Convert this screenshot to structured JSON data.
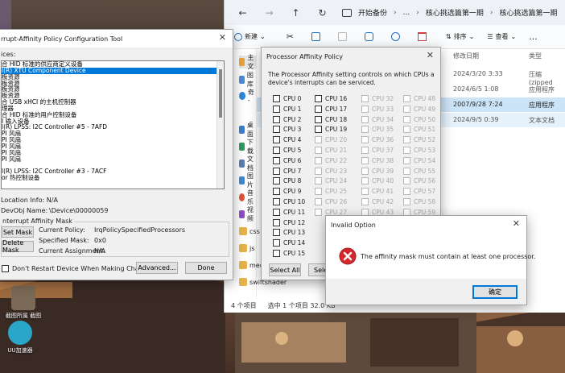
{
  "explorer": {
    "breadcrumb": [
      "开始备份",
      "...",
      "核心挑选篇第一期",
      "核心挑选篇第一期"
    ],
    "toolbar": {
      "new_label": "新建",
      "sort_label": "排序",
      "view_label": "查看",
      "more_label": "..."
    },
    "nav": [
      "主文",
      "图库",
      "奇 -",
      "桌面",
      "下载",
      "文档",
      "图片",
      "音乐",
      "视频",
      "css",
      "js",
      "med",
      "swiftshader"
    ],
    "columns": {
      "date": "修改日期",
      "type": "类型"
    },
    "rows": [
      {
        "date": "2024/3/20 3:33",
        "type": "压缩(zipped",
        "state": "normal"
      },
      {
        "date": "2024/6/5 1:08",
        "type": "应用程序",
        "state": "normal"
      },
      {
        "date": "2007/9/28 7:24",
        "type": "应用程序",
        "state": "selected"
      },
      {
        "date": "2024/9/5 0:39",
        "type": "文本文档",
        "state": "hover"
      }
    ],
    "status": {
      "count": "4 个项目",
      "selected": "选中 1 个项目  32.0 KB"
    }
  },
  "config_dialog": {
    "title": "rrupt-Affinity Policy Configuration Tool",
    "devices_label": "ices:",
    "devices": [
      "合 HID 标准的供应商定义设备",
      "l(R) XTU Component Device",
      "板资源",
      "板资源",
      "板资源",
      "板资源",
      "合 USB xHCI 的主机控制器",
      "理器",
      "合 HID 标准的用户控制设备",
      "I 输入设备",
      "l(R) LPSS: I2C Controller #5 - 7AFD",
      "PI 风扇",
      "PI 风扇",
      "PI 风扇",
      "PI 风扇",
      "PI 风扇",
      "",
      "l(R) LPSS: I2C Controller #3 - 7ACF",
      "or 热控制设备"
    ],
    "selected_device_index": 1,
    "location_info": "Location Info: N/A",
    "devobj_label": "DevObj Name:",
    "devobj_value": "\\Device\\00000059",
    "mask_group": "nterrupt Affinity Mask",
    "set_mask": "Set Mask",
    "delete_mask": "Delete Mask",
    "current_policy_label": "Current Policy:",
    "current_policy_value": "IrqPolicySpecifiedProcessors",
    "specified_mask_label": "Specified Mask:",
    "specified_mask_value": "0x0",
    "current_assignment_label": "Current Assignment:",
    "current_assignment_value": "N/A",
    "dont_restart": "Don't Restart Device When Making Changes",
    "advanced": "Advanced...",
    "done": "Done"
  },
  "affinity_dialog": {
    "title": "Processor Affinity Policy",
    "description": "The Processor Affinity setting controls on which CPUs a device's interrupts can be serviced.",
    "columns": [
      {
        "enabled": true,
        "cpus": [
          "CPU 0",
          "CPU 1",
          "CPU 2",
          "CPU 3",
          "CPU 4",
          "CPU 5",
          "CPU 6",
          "CPU 7",
          "CPU 8",
          "CPU 9",
          "CPU 10",
          "CPU 11",
          "CPU 12",
          "CPU 13",
          "CPU 14",
          "CPU 15"
        ]
      },
      {
        "enabled": "mixed",
        "cpus": [
          "CPU 16",
          "CPU 17",
          "CPU 18",
          "CPU 19",
          "CPU 20",
          "CPU 21",
          "CPU 22",
          "CPU 23",
          "CPU 24",
          "CPU 25",
          "CPU 26",
          "CPU 27"
        ]
      },
      {
        "enabled": false,
        "cpus": [
          "CPU 32",
          "CPU 33",
          "CPU 34",
          "CPU 35",
          "CPU 36",
          "CPU 37",
          "CPU 38",
          "CPU 39",
          "CPU 40",
          "CPU 41",
          "CPU 42",
          "CPU 43"
        ]
      },
      {
        "enabled": false,
        "cpus": [
          "CPU 48",
          "CPU 49",
          "CPU 50",
          "CPU 51",
          "CPU 52",
          "CPU 53",
          "CPU 54",
          "CPU 55",
          "CPU 56",
          "CPU 57",
          "CPU 58",
          "CPU 59"
        ]
      }
    ],
    "select_all": "Select All",
    "select_partial": "Sele"
  },
  "error_dialog": {
    "title": "Invalid Option",
    "message": "The affinity mask must contain at least one processor.",
    "ok": "确定"
  },
  "desktop_icons": [
    {
      "label": "截图所属\n截图"
    },
    {
      "label": "UU加速器"
    }
  ],
  "colors": {
    "accent": "#0078d7",
    "error": "#d3272e",
    "selection": "#cce4f7"
  }
}
